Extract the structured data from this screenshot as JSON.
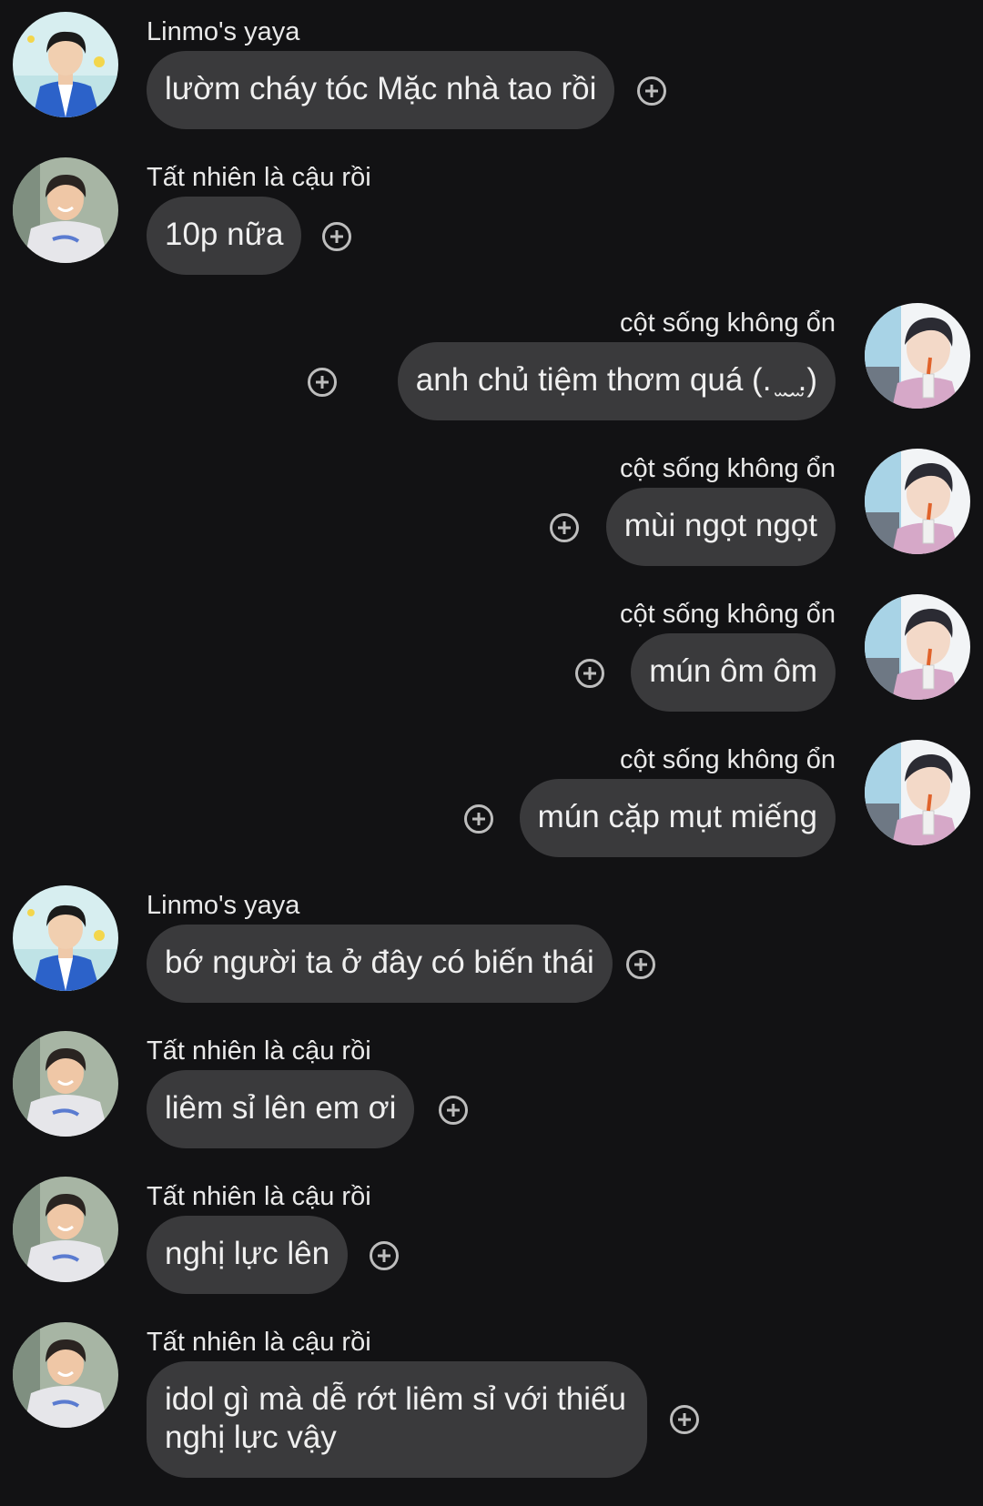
{
  "messages": [
    {
      "sender": "Linmo's yaya",
      "text": "lườm cháy tóc Mặc nhà tao rồi",
      "avatar_icon": "avatar-blue-jacket-icon"
    },
    {
      "sender": "Tất nhiên là cậu rồi",
      "text": "10p nữa",
      "avatar_icon": "avatar-gray-hoodie-icon"
    },
    {
      "sender": "cột sống không ổn",
      "text": "anh chủ tiệm thơm quá (. ̫ ̮ ̫.)",
      "avatar_icon": "avatar-straw-drink-icon"
    },
    {
      "sender": "cột sống không ổn",
      "text": "mùi ngọt ngọt",
      "avatar_icon": "avatar-straw-drink-icon"
    },
    {
      "sender": "cột sống không ổn",
      "text": "mún ôm ôm",
      "avatar_icon": "avatar-straw-drink-icon"
    },
    {
      "sender": "cột sống không ổn",
      "text": "mún cặp mụt miếng",
      "avatar_icon": "avatar-straw-drink-icon"
    },
    {
      "sender": "Linmo's yaya",
      "text": "bớ người ta ở đây có biến thái",
      "avatar_icon": "avatar-blue-jacket-icon"
    },
    {
      "sender": "Tất nhiên là cậu rồi",
      "text": "liêm sỉ lên em ơi",
      "avatar_icon": "avatar-gray-hoodie-icon"
    },
    {
      "sender": "Tất nhiên là cậu rồi",
      "text": "nghị lực lên",
      "avatar_icon": "avatar-gray-hoodie-icon"
    },
    {
      "sender": "Tất nhiên là cậu rồi",
      "text": "idol gì mà dễ rớt liêm sỉ với thiếu nghị lực vậy",
      "avatar_icon": "avatar-gray-hoodie-icon"
    }
  ],
  "colors": {
    "background": "#121214",
    "bubble": "#3a3a3c",
    "text": "#f0f0f0",
    "add_icon": "#bdbdbd"
  }
}
